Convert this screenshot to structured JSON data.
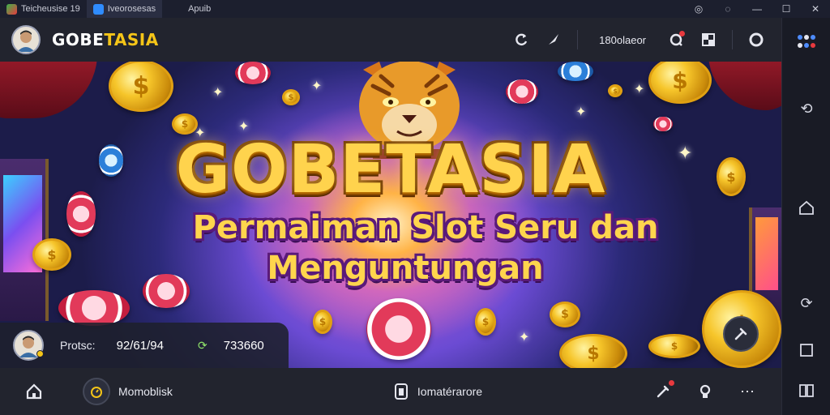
{
  "window": {
    "tabs": [
      {
        "label": "Teicheusise 19",
        "icon": "app-icon"
      },
      {
        "label": "Iveorosesas",
        "icon": "blue-square-icon"
      },
      {
        "label": "Apuib",
        "icon": "none"
      }
    ],
    "controls": [
      "help-icon",
      "chat-icon",
      "minimize-icon",
      "maximize-icon",
      "close-icon"
    ]
  },
  "header": {
    "brand_part1": "GOBE",
    "brand_part2": "TASIA",
    "status_text": "180olaeor",
    "icons": [
      "refresh-icon",
      "rocket-icon",
      "settings-badge-icon",
      "layout-icon",
      "circle-icon"
    ]
  },
  "banner": {
    "title": "GOBETASIA",
    "subtitle_line1": "Permaiman Slot Seru dan",
    "subtitle_line2": "Menguntungan"
  },
  "player": {
    "label": "Protsc:",
    "value": "92/61/94",
    "coin_symbol": "⟳",
    "score": "733660"
  },
  "bottom": {
    "home_icon": "home-icon",
    "item_label": "Momoblisk",
    "center_label": "Iomatérarore"
  },
  "sidebar": [
    "apps-icon",
    "refresh-arrows-icon",
    "home-outline-icon",
    "rotate-icon",
    "square-icon",
    "split-icon"
  ],
  "colors": {
    "accent": "#f5c518",
    "background": "#22242e",
    "gold_text": "#ffd34d"
  }
}
